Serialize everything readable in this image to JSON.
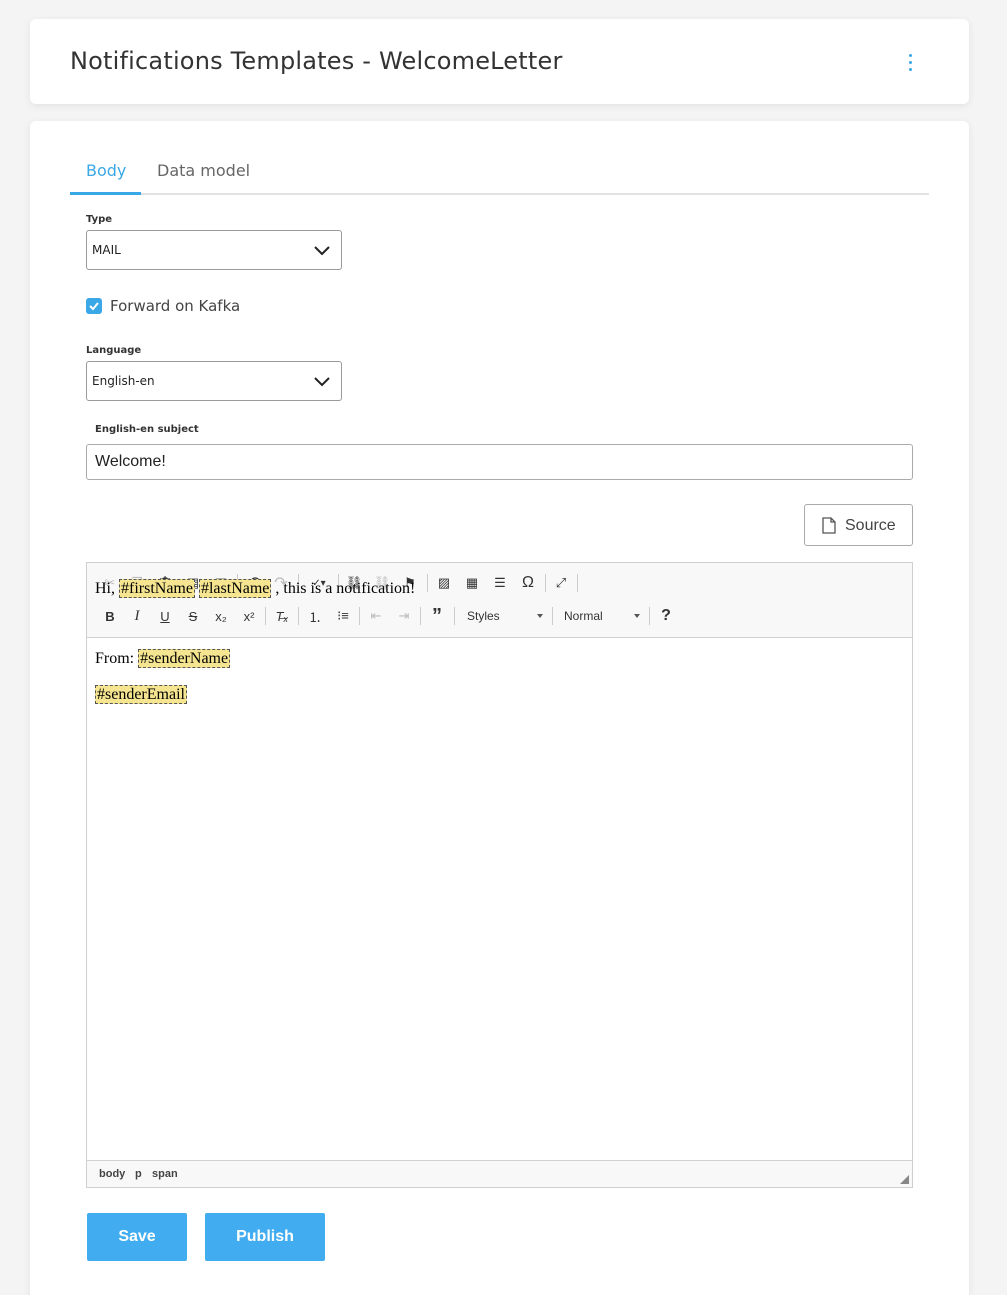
{
  "header": {
    "title": "Notifications Templates - WelcomeLetter",
    "menu_icon": "kebab-vertical-icon",
    "accent": "#3aa7e6"
  },
  "tabs": [
    {
      "label": "Body",
      "active": true
    },
    {
      "label": "Data model",
      "active": false
    }
  ],
  "form": {
    "type_label": "Type",
    "type_value": "MAIL",
    "forward_label": "Forward on Kafka",
    "forward_checked": true,
    "language_label": "Language",
    "language_value": "English-en",
    "subject_label": "English-en subject",
    "subject_value": "Welcome!"
  },
  "editor": {
    "source_label": "Source",
    "styles_label": "Styles",
    "format_label": "Normal",
    "help_label": "?",
    "content": {
      "line1_prefix": "Hi, ",
      "ph_first": "#firstName",
      "ph_last": "#lastName",
      "line1_suffix": " , this is a notification!",
      "line2_prefix": "From: ",
      "ph_sender": "#senderName",
      "ph_email": "#senderEmail"
    },
    "path": [
      "body",
      "p",
      "span"
    ]
  },
  "actions": {
    "save_label": "Save",
    "publish_label": "Publish",
    "button_color": "#41adf0"
  }
}
